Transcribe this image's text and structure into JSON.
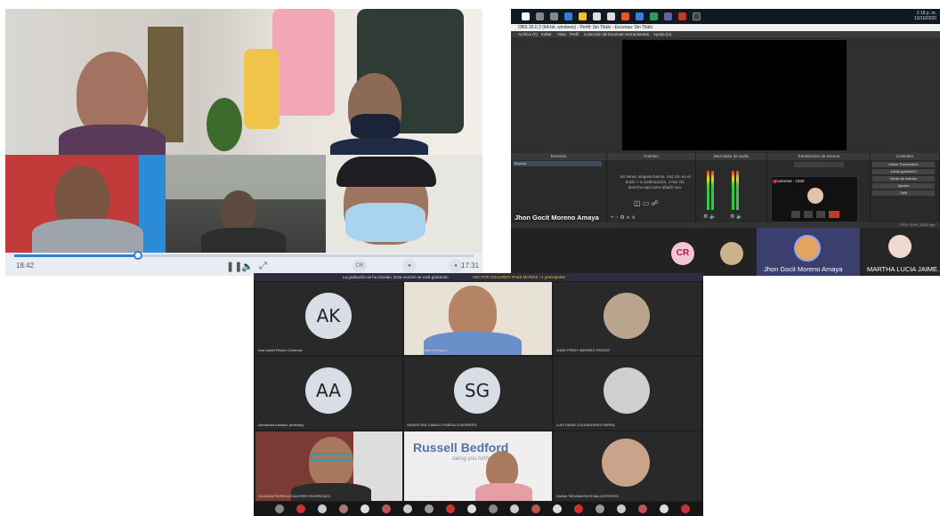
{
  "panel1": {
    "time_elapsed": "18:42",
    "time_remaining": "17:31",
    "progress_fraction": 0.27,
    "buttons": {
      "presenter": "CR"
    }
  },
  "panel2": {
    "window_title": "OBS 26.0.2 (64-bit, windows) - Perfil: Sin Titulo - Escenas: Sin Titulo",
    "clock": "2:18 p. m.",
    "date": "13/10/2020",
    "menu": [
      "Archivo (F)",
      "Editar",
      "Vista",
      "Perfil",
      "Colección de Escenas",
      "Herramientas",
      "Ayuda (H)"
    ],
    "docks": [
      "Escenas",
      "Fuentes",
      "Mezclador de audio",
      "Transiciones de escena",
      "Controles"
    ],
    "scene_item": "Escena",
    "sources_hint": "No tienes ninguna fuente. Haz clic en el botón + a continuación, o haz clic derecho aquí para añadir una.",
    "controls": [
      "Iniciar Transmisión",
      "Iniciar grabación",
      "Modo de estudio",
      "Ajustes",
      "Salir"
    ],
    "popup_title": "Camera4 - 1920",
    "status": "CPU: 6.8%, 30.00 fps",
    "presenter_overlay": "Jhon Gocit Moreno Amaya",
    "avatars": [
      {
        "initials": "CR",
        "bg": "#f3c6d1",
        "fg": "#a0224c"
      }
    ],
    "tiles": [
      {
        "name": "Jhon Gocit Moreno Amaya"
      },
      {
        "name": "MARTHA LUCIA JAIME..."
      }
    ]
  },
  "panel3": {
    "banner": "La grabación se ha iniciado. Esta reunión se está grabando.",
    "banner_by": "HECTOR EDUARDO PAEZ MUÑOZ +1 participante",
    "tiles": [
      {
        "initials": "AK",
        "name": "Ana Isabel Reyes Cárdenas"
      },
      {
        "name": "Nicolás Gómez (Invitado)"
      },
      {
        "name": "JUAN FREDY MENDEZ OSORIO"
      },
      {
        "initials": "AA",
        "name": "Alexandra Arellano (Invitado)"
      },
      {
        "initials": "SG",
        "name": "SEBASTIAN CAMILO PINEDA GUERRERO"
      },
      {
        "name": "LUIS DAVID COLMENARES PARRA"
      },
      {
        "name": "CLAUDIA PATRICIA CACERES RODRIGUEZ"
      },
      {
        "name": "Sebastián Méndez (Invitado)",
        "sign": "Russell Bedford",
        "sign_sub": "taking you further"
      },
      {
        "name": "DIANA TATIANA RIOS BALLESTEROS"
      }
    ]
  },
  "colors": {
    "accent_blue": "#2f7ed8",
    "teams_bg": "#1f1f1f",
    "obs_bg": "#2b2b2b",
    "record_red": "#e02020"
  }
}
